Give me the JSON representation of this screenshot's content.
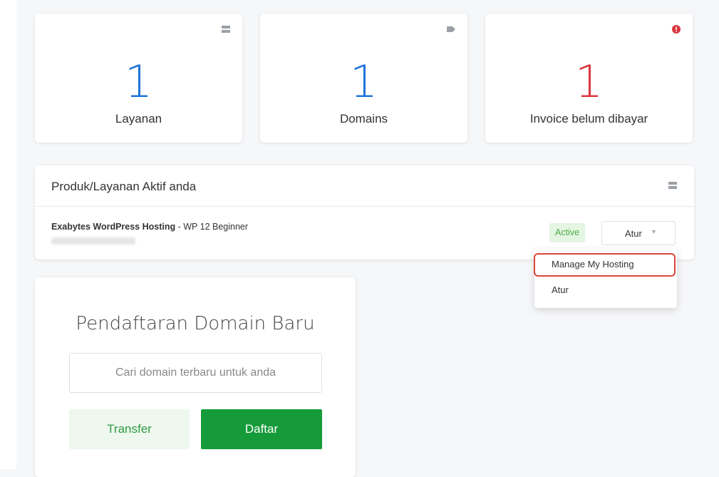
{
  "stats": [
    {
      "value": "1",
      "label": "Layanan",
      "icon": "server-icon",
      "color": "#1f73d8"
    },
    {
      "value": "1",
      "label": "Domains",
      "icon": "tag-icon",
      "color": "#1f73d8"
    },
    {
      "value": "1",
      "label": "Invoice belum dibayar",
      "icon": "alert-icon",
      "color": "#d9363e"
    }
  ],
  "products": {
    "title": "Produk/Layanan Aktif anda",
    "icon": "server-icon",
    "item": {
      "product_name": "Exabytes WordPress Hosting",
      "plan": " - WP 12 Beginner",
      "status": "Active",
      "action_label": "Atur"
    }
  },
  "dropdown": {
    "items": [
      "Manage My Hosting",
      "Atur"
    ]
  },
  "domain_registration": {
    "title": "Pendaftaran Domain Baru",
    "search_placeholder": "Cari domain terbaru untuk anda",
    "transfer_label": "Transfer",
    "register_label": "Daftar"
  }
}
